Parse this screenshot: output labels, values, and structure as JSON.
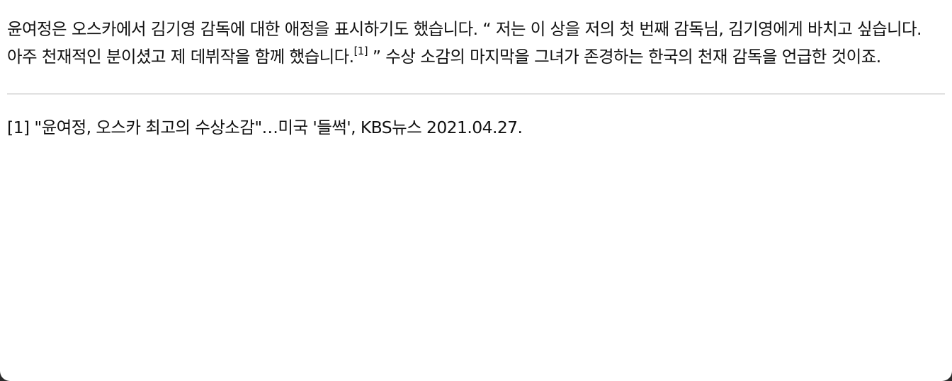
{
  "article": {
    "paragraph_before": "윤여정은 오스카에서 김기영 감독에 대한 애정을 표시하기도 했습니다. “ 저는 이 상을 저의 첫 번째 감독님, 김기영에게 바치고 싶습니다. 아주 천재적인 분이셨고 제 데뷔작을 함께 했습니다.",
    "footnote_ref": "[1]",
    "paragraph_after": " ” 수상 소감의 마지막을 그녀가 존경하는 한국의 천재 감독을 언급한 것이죠."
  },
  "footnotes": [
    {
      "marker": "[1]",
      "text": " \"윤여정, 오스카 최고의 수상소감\"…미국 '들썩', KBS뉴스 2021.04.27."
    }
  ]
}
